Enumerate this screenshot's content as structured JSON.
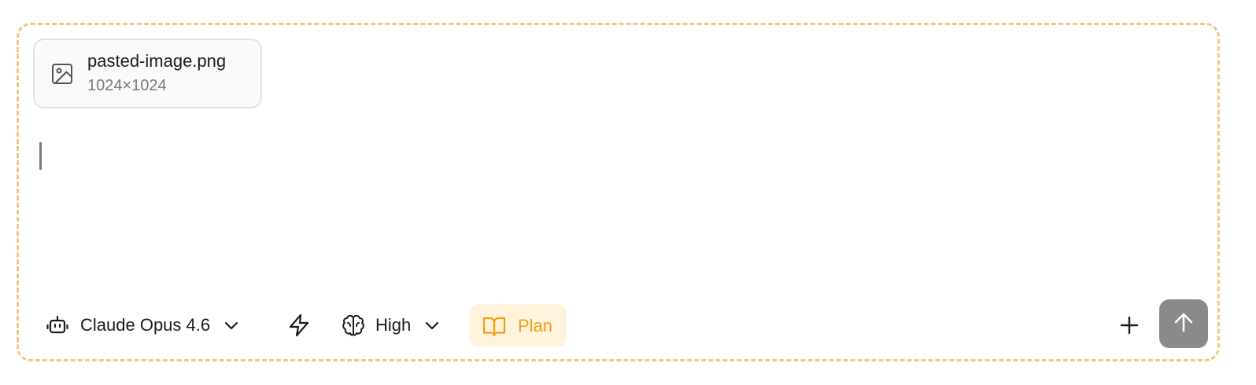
{
  "attachment": {
    "icon": "image-icon",
    "filename": "pasted-image.png",
    "dimensions": "1024×1024"
  },
  "input": {
    "value": "",
    "placeholder": ""
  },
  "toolbar": {
    "model": {
      "icon": "robot-icon",
      "label": "Claude Opus 4.6",
      "chevron": "chevron-down-icon"
    },
    "fast_mode": {
      "icon": "lightning-bolt-icon"
    },
    "effort": {
      "icon": "brain-icon",
      "label": "High",
      "chevron": "chevron-down-icon"
    },
    "plan": {
      "icon": "open-book-icon",
      "label": "Plan",
      "active": true
    },
    "add": {
      "icon": "plus-icon"
    },
    "send": {
      "icon": "arrow-up-icon",
      "enabled": false
    }
  },
  "colors": {
    "border_dashed": "#f5c77e",
    "plan_accent": "#f0a010",
    "plan_bg": "#fff3de",
    "send_bg_disabled": "#8a8a8a",
    "text_primary": "#1c1c1c",
    "text_secondary": "#7a7a7a"
  }
}
